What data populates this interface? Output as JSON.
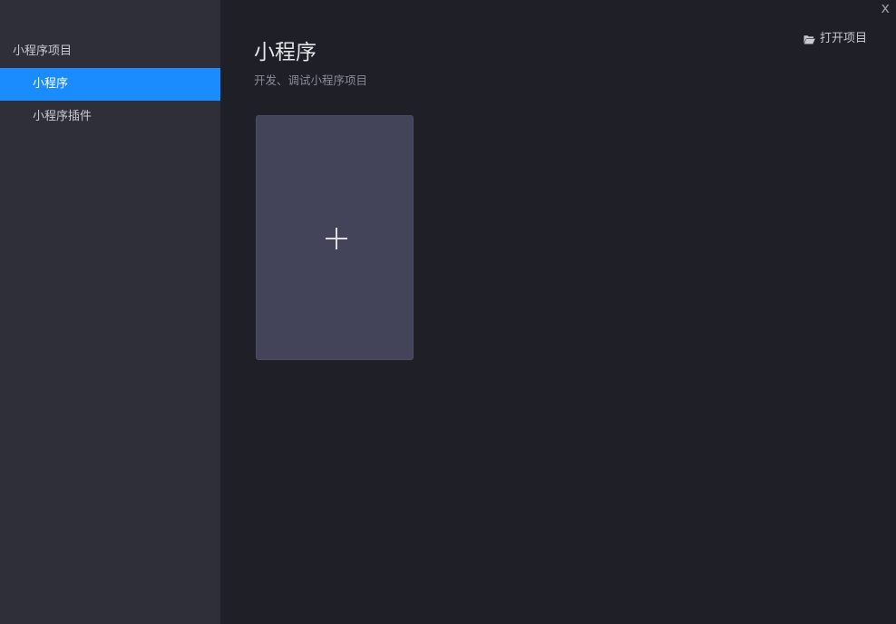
{
  "sidebar": {
    "section_title": "小程序项目",
    "items": [
      {
        "label": "小程序",
        "active": true
      },
      {
        "label": "小程序插件",
        "active": false
      }
    ]
  },
  "main": {
    "title": "小程序",
    "subtitle": "开发、调试小程序项目",
    "open_project_label": "打开项目",
    "open_project_icon": "folder-open-icon",
    "create_icon": "plus-icon"
  },
  "window": {
    "close_label": "x"
  },
  "colors": {
    "sidebar_bg": "#2f2f3a",
    "main_bg": "#1f1f28",
    "accent": "#1b8cfd",
    "card_bg": "#43445a"
  }
}
